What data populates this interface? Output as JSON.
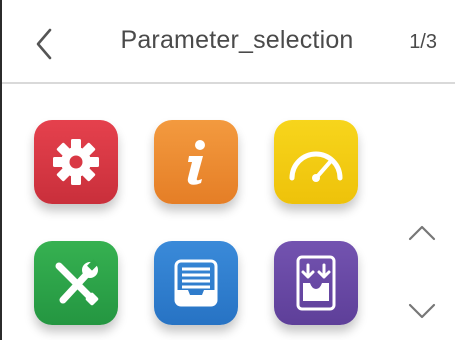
{
  "header": {
    "back_icon": "chevron-left-icon",
    "title": "Parameter_selection",
    "page_indicator": "1/3"
  },
  "tiles": [
    {
      "name": "settings",
      "icon": "gear-icon",
      "color": "#d93844"
    },
    {
      "name": "info",
      "icon": "info-icon",
      "color": "#ee8a30"
    },
    {
      "name": "performance",
      "icon": "speedometer-icon",
      "color": "#f3cb12"
    },
    {
      "name": "tools",
      "icon": "wrench-screwdriver-icon",
      "color": "#2fa64a"
    },
    {
      "name": "storage",
      "icon": "inbox-tray-icon",
      "color": "#2f7fd0"
    },
    {
      "name": "download",
      "icon": "download-box-icon",
      "color": "#6a4aa6"
    }
  ],
  "navigation": {
    "up_icon": "chevron-up-icon",
    "down_icon": "chevron-down-icon"
  },
  "colors": {
    "text": "#4a4a4a",
    "divider": "#d9d9d9",
    "arrow": "#777777"
  }
}
